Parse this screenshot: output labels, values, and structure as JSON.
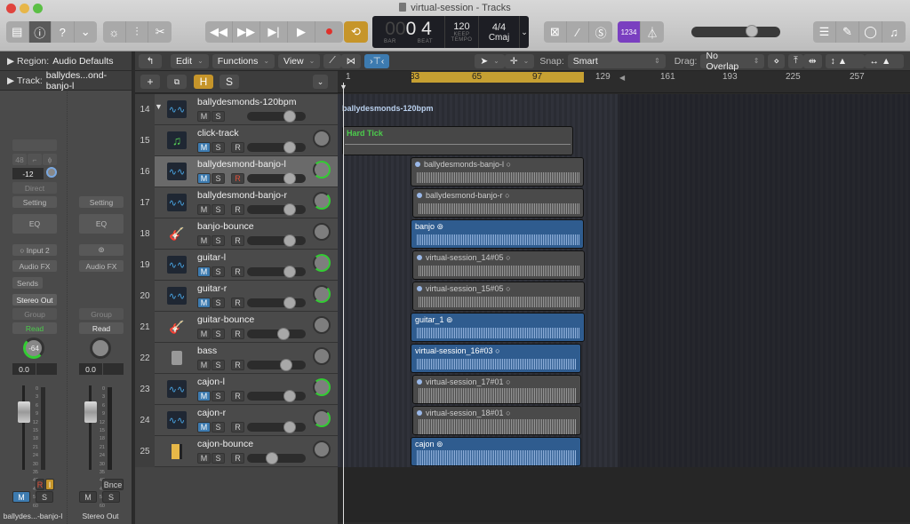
{
  "window": {
    "title": "virtual-session - Tracks"
  },
  "toolbar": {
    "left_buttons": [
      "library-icon",
      "info-icon",
      "help-icon",
      "toolbar-icon"
    ],
    "edit_buttons": [
      "smart-controls-icon",
      "mixer-icon",
      "scissors-icon"
    ],
    "transport": [
      "rewind-icon",
      "fast-forward-icon",
      "go-to-end-icon",
      "play-icon",
      "record-icon",
      "cycle-icon"
    ],
    "lcd": {
      "bar_prefix": "00",
      "bar": "0",
      "beat": "4",
      "bar_label": "BAR",
      "beat_label": "BEAT",
      "tempo": "120",
      "tempo_mode": "KEEP",
      "tempo_label": "TEMPO",
      "signature": "4/4",
      "key": "Cmaj"
    },
    "modes": [
      "replace-icon",
      "tuner-icon",
      "solo-icon"
    ],
    "count_in": "1234",
    "metronome": "metronome-icon",
    "master_volume": 0.7,
    "right_buttons": [
      "list-editors-icon",
      "notepad-icon",
      "loops-icon",
      "browsers-icon"
    ]
  },
  "inspector": {
    "region_label": "Region:",
    "region_value": "Audio Defaults",
    "track_label": "Track:",
    "track_value": "ballydes...ond-banjo-l",
    "strip1": {
      "sample_rate": "48",
      "gain": "-12",
      "direct": "Direct",
      "setting": "Setting",
      "eq": "EQ",
      "input": "Input 2",
      "audio_fx": "Audio FX",
      "sends": "Sends",
      "output": "Stereo Out",
      "group": "Group",
      "automation": "Read",
      "pan": "-64",
      "volume": "0.0",
      "r_label": "R",
      "i_label": "I",
      "mute": "M",
      "solo": "S",
      "name": "ballydes...-banjo-l"
    },
    "strip2": {
      "setting": "Setting",
      "eq": "EQ",
      "audio_fx": "Audio FX",
      "group": "Group",
      "automation": "Read",
      "volume": "0.0",
      "bounce": "Bnce",
      "mute": "M",
      "solo": "S",
      "name": "Stereo Out"
    },
    "meter_scale": [
      "0",
      "3",
      "6",
      "9",
      "12",
      "15",
      "18",
      "21",
      "24",
      "30",
      "35",
      "40",
      "45",
      "50",
      "60"
    ]
  },
  "tracks_toolbar": {
    "edit": "Edit",
    "functions": "Functions",
    "view": "View",
    "snap_label": "Snap:",
    "snap_value": "Smart",
    "drag_label": "Drag:",
    "drag_value": "No Overlap"
  },
  "header_bar": {
    "add": "+",
    "h": "H",
    "s": "S"
  },
  "ruler": {
    "marks": [
      "1",
      "33",
      "65",
      "97",
      "129",
      "161",
      "193",
      "225",
      "257"
    ]
  },
  "tracks": [
    {
      "num": "14",
      "name": "ballydesmonds-120bpm",
      "icon": "waveform-icon",
      "buttons": [
        "M",
        "S"
      ],
      "mute_on": false,
      "rec": false,
      "folder": true,
      "vol": 0.72
    },
    {
      "num": "15",
      "name": "click-track",
      "icon": "music-note-icon",
      "buttons": [
        "M",
        "S",
        "R"
      ],
      "mute_on": true,
      "rec": false,
      "vol": 0.72
    },
    {
      "num": "16",
      "name": "ballydesmond-banjo-l",
      "icon": "waveform-icon",
      "buttons": [
        "M",
        "S",
        "R"
      ],
      "mute_on": true,
      "rec": true,
      "vol": 0.72,
      "selected": true,
      "pan": "left"
    },
    {
      "num": "17",
      "name": "ballydesmond-banjo-r",
      "icon": "waveform-icon",
      "buttons": [
        "M",
        "S",
        "R"
      ],
      "mute_on": false,
      "rec": false,
      "vol": 0.72,
      "pan": "right"
    },
    {
      "num": "18",
      "name": "banjo-bounce",
      "icon": "guitar-icon",
      "buttons": [
        "M",
        "S",
        "R"
      ],
      "mute_on": false,
      "rec": false,
      "vol": 0.72
    },
    {
      "num": "19",
      "name": "guitar-l",
      "icon": "waveform-icon",
      "buttons": [
        "M",
        "S",
        "R"
      ],
      "mute_on": true,
      "rec": false,
      "vol": 0.72,
      "pan": "left"
    },
    {
      "num": "20",
      "name": "guitar-r",
      "icon": "waveform-icon",
      "buttons": [
        "M",
        "S",
        "R"
      ],
      "mute_on": true,
      "rec": false,
      "vol": 0.72,
      "pan": "right"
    },
    {
      "num": "21",
      "name": "guitar-bounce",
      "icon": "guitar-icon",
      "buttons": [
        "M",
        "S",
        "R"
      ],
      "mute_on": false,
      "rec": false,
      "vol": 0.62
    },
    {
      "num": "22",
      "name": "bass",
      "icon": "amp-icon",
      "buttons": [
        "M",
        "S",
        "R"
      ],
      "mute_on": false,
      "rec": false,
      "vol": 0.66
    },
    {
      "num": "23",
      "name": "cajon-l",
      "icon": "waveform-icon",
      "buttons": [
        "M",
        "S",
        "R"
      ],
      "mute_on": true,
      "rec": false,
      "vol": 0.72,
      "pan": "left"
    },
    {
      "num": "24",
      "name": "cajon-r",
      "icon": "waveform-icon",
      "buttons": [
        "M",
        "S",
        "R"
      ],
      "mute_on": true,
      "rec": false,
      "vol": 0.72,
      "pan": "right"
    },
    {
      "num": "25",
      "name": "cajon-bounce",
      "icon": "cajon-icon",
      "buttons": [
        "M",
        "S",
        "R"
      ],
      "mute_on": false,
      "rec": false,
      "vol": 0.42
    }
  ],
  "regions": [
    {
      "label": "ballydesmonds-120bpm",
      "type": "folder"
    },
    {
      "label": "Hard Tick",
      "type": "midi"
    },
    {
      "label": "ballydesmonds-banjo-l",
      "type": "grey"
    },
    {
      "label": "ballydesmond-banjo-r",
      "type": "grey"
    },
    {
      "label": "banjo",
      "type": "blue",
      "link": true
    },
    {
      "label": "virtual-session_14#05",
      "type": "grey"
    },
    {
      "label": "virtual-session_15#05",
      "type": "grey"
    },
    {
      "label": "guitar_1",
      "type": "blue",
      "link": true
    },
    {
      "label": "virtual-session_16#03",
      "type": "blue"
    },
    {
      "label": "virtual-session_17#01",
      "type": "grey"
    },
    {
      "label": "virtual-session_18#01",
      "type": "grey"
    },
    {
      "label": "cajon",
      "type": "blue",
      "link": true
    }
  ],
  "colors": {
    "cycle": "#c6a032",
    "mute_on": "#3d7bb0",
    "count_in": "#7a3fc0",
    "green": "#33cc33"
  }
}
